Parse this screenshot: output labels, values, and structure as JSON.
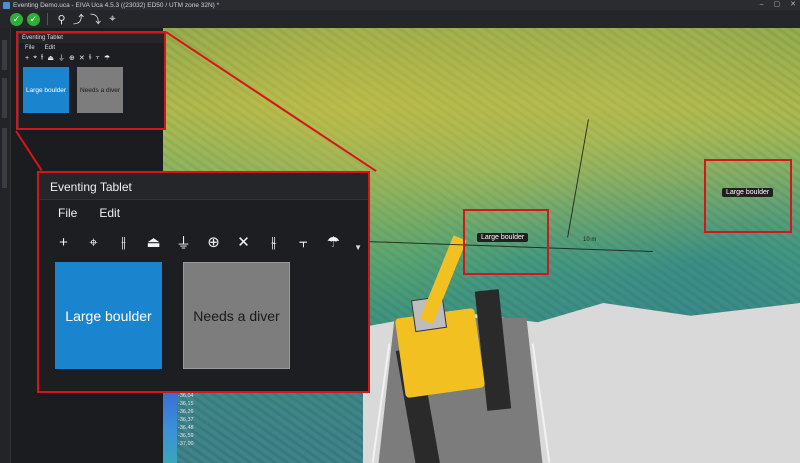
{
  "window": {
    "title": "Eventing Demo.uca - EIVA Uca 4.5.3 ((23032) ED50 / UTM zone 32N) *"
  },
  "toolbar": {
    "icons": [
      "check-circle-icon",
      "check-circle-icon",
      "pin-icon",
      "route-icon",
      "route-icon",
      "route-icon"
    ]
  },
  "tablet": {
    "title": "Eventing Tablet",
    "menu": [
      "File",
      "Edit"
    ],
    "tools": [
      "+",
      "⌖",
      "⫲",
      "⏏",
      "⏚",
      "⊕",
      "✕",
      "⫳",
      "⫟",
      "☂"
    ],
    "tiles": [
      {
        "label": "Large boulder",
        "color": "#1a84cf"
      },
      {
        "label": "Needs a diver",
        "color": "#7d7d7d"
      }
    ]
  },
  "scene": {
    "labels": [
      "Large boulder",
      "Large boulder"
    ],
    "measurement": "10 m",
    "legend_values": [
      "-36,04",
      "-36,15",
      "-36,26",
      "-36,37",
      "-36,48",
      "-36,59",
      "-37,00"
    ]
  }
}
